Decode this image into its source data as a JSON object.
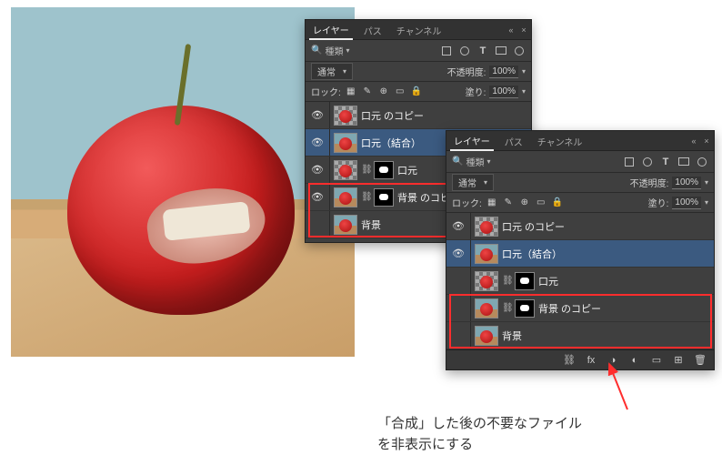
{
  "tabs": {
    "layers": "レイヤー",
    "paths": "パス",
    "channels": "チャンネル"
  },
  "filter": {
    "label": "種類"
  },
  "blend": {
    "mode": "通常",
    "opacity_label": "不透明度:",
    "opacity_value": "100%"
  },
  "lock": {
    "label": "ロック:",
    "fill_label": "塗り:",
    "fill_value": "100%"
  },
  "layers_list": [
    {
      "name": "口元 のコピー",
      "visible": true,
      "selected": false,
      "thumb": "trans",
      "mask": false
    },
    {
      "name": "口元（結合）",
      "visible": true,
      "selected": true,
      "thumb": "applebg",
      "mask": false
    },
    {
      "name": "口元",
      "visible": true,
      "selected": false,
      "thumb": "trans",
      "mask": true
    },
    {
      "name": "背景 のコピー",
      "visible": true,
      "selected": false,
      "thumb": "applebg",
      "mask": true
    },
    {
      "name": "背景",
      "visible": false,
      "selected": false,
      "thumb": "applebg",
      "mask": false
    }
  ],
  "panel2_visibility": [
    true,
    true,
    false,
    false,
    false
  ],
  "annotation": {
    "line1": "「合成」した後の不要なファイル",
    "line2": "を非表示にする"
  }
}
